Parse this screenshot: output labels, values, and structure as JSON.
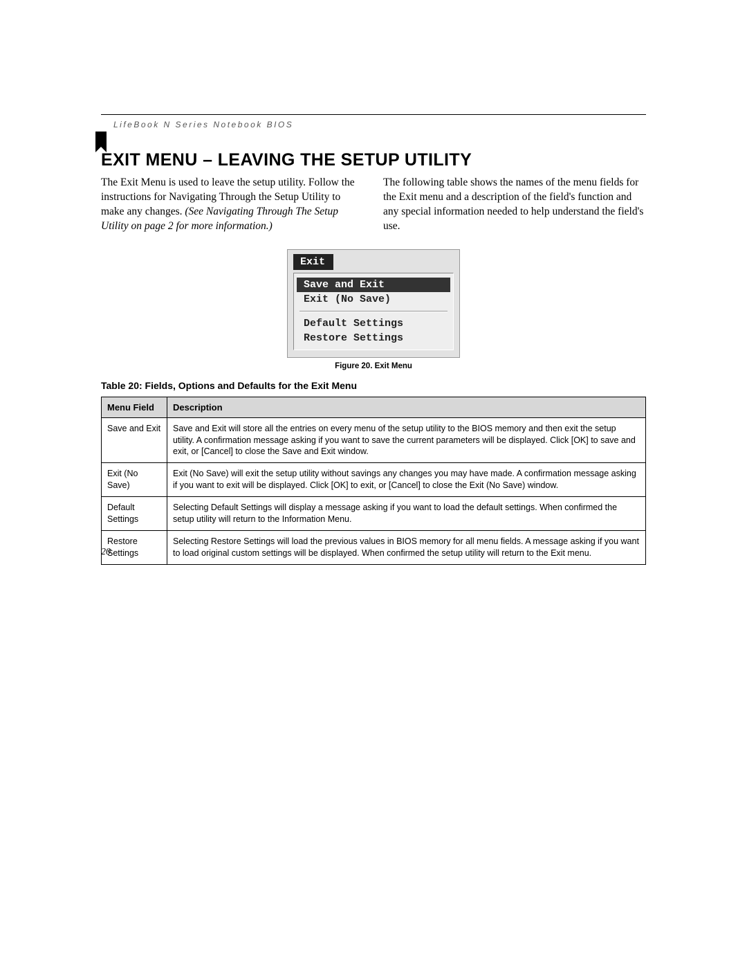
{
  "header": {
    "running_head": "LifeBook N Series Notebook BIOS"
  },
  "title": "EXIT MENU – LEAVING THE SETUP UTILITY",
  "body": {
    "left_para_1": "The Exit Menu is used to leave the setup utility. Follow the instructions for Navigating Through the Setup Utility to make any changes. ",
    "left_para_1_italic": "(See Navigating Through The Setup Utility on page 2 for more information.)",
    "right_para": "The following table shows the names of the menu fields for the Exit menu and a description of the field's function and any special information needed to help understand the field's use."
  },
  "bios": {
    "tab": "Exit",
    "items": [
      {
        "label": "Save and Exit",
        "selected": true
      },
      {
        "label": "Exit (No Save)",
        "selected": false
      }
    ],
    "items2": [
      {
        "label": "Default Settings"
      },
      {
        "label": "Restore Settings"
      }
    ]
  },
  "figure_caption": "Figure 20.  Exit Menu",
  "table_title": "Table 20: Fields, Options and Defaults for the Exit Menu",
  "table": {
    "headers": {
      "field": "Menu Field",
      "desc": "Description"
    },
    "rows": [
      {
        "field": "Save and Exit",
        "desc": "Save and Exit will store all the entries on every menu of the setup utility to the BIOS memory and then exit the setup utility. A confirmation message asking if you want to save the current parameters will be displayed. Click [OK] to save and exit, or [Cancel] to close the Save and Exit window."
      },
      {
        "field": "Exit (No Save)",
        "desc": "Exit (No Save) will exit the setup utility without savings any changes you may have made. A confirmation message asking if you want to exit will be displayed. Click [OK] to exit, or [Cancel] to close the Exit (No Save) window."
      },
      {
        "field": "Default Settings",
        "desc": "Selecting Default Settings will display a message asking if you want to load the default settings. When confirmed the setup utility will return to the Information Menu."
      },
      {
        "field": "Restore Settings",
        "desc": "Selecting Restore Settings will load the previous values in BIOS memory for all menu fields. A message asking if you want to load original custom settings will be displayed. When confirmed the setup utility will return to the Exit menu."
      }
    ]
  },
  "page_number": "20"
}
